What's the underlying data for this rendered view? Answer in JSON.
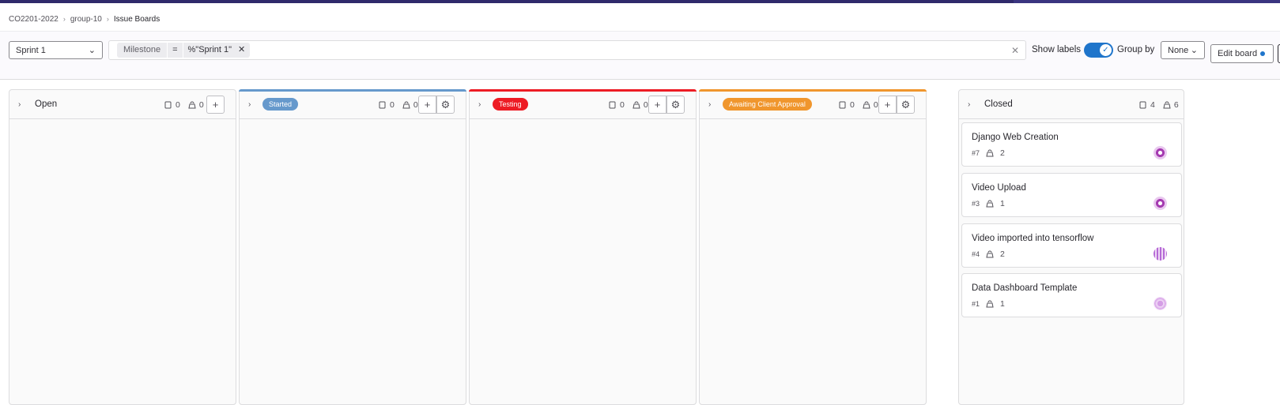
{
  "breadcrumb": {
    "group": "CO2201-2022",
    "project": "group-10",
    "page": "Issue Boards",
    "sep": "›"
  },
  "filter": {
    "sprint_select": "Sprint 1",
    "token_key": "Milestone",
    "token_op": "=",
    "token_value": "%\"Sprint 1\"",
    "token_remove": "✕",
    "clear": "✕",
    "show_labels": "Show labels",
    "show_labels_on": true,
    "group_by": "Group by",
    "group_by_value": "None",
    "edit_board": "Edit board"
  },
  "icons": {
    "chevron_right": "›",
    "chevron_down": "⌄",
    "issues": "issues-icon",
    "weight": "weight-icon",
    "plus": "+",
    "gear": "⚙",
    "check": "✓"
  },
  "columns": [
    {
      "title": "Open",
      "issues": "0",
      "weight": "0",
      "type": "plain",
      "color": ""
    },
    {
      "title": "Started",
      "issues": "0",
      "weight": "0",
      "type": "label",
      "color": "#6699cc"
    },
    {
      "title": "Testing",
      "issues": "0",
      "weight": "0",
      "type": "label",
      "color": "#ed1c24"
    },
    {
      "title": "Awaiting Client Approval",
      "issues": "0",
      "weight": "0",
      "type": "label",
      "color": "#f0962d"
    },
    {
      "title": "Closed",
      "issues": "4",
      "weight": "6",
      "type": "plain",
      "color": ""
    }
  ],
  "cards": [
    {
      "title": "Django Web Creation",
      "ref": "#7",
      "weight": "2",
      "avatar_color": "#a53bb1"
    },
    {
      "title": "Video Upload",
      "ref": "#3",
      "weight": "1",
      "avatar_color": "#a53bb1"
    },
    {
      "title": "Video imported into tensorflow",
      "ref": "#4",
      "weight": "2",
      "avatar_color": "#b56ad6"
    },
    {
      "title": "Data Dashboard Template",
      "ref": "#1",
      "weight": "1",
      "avatar_color": "#d59ee6"
    }
  ]
}
